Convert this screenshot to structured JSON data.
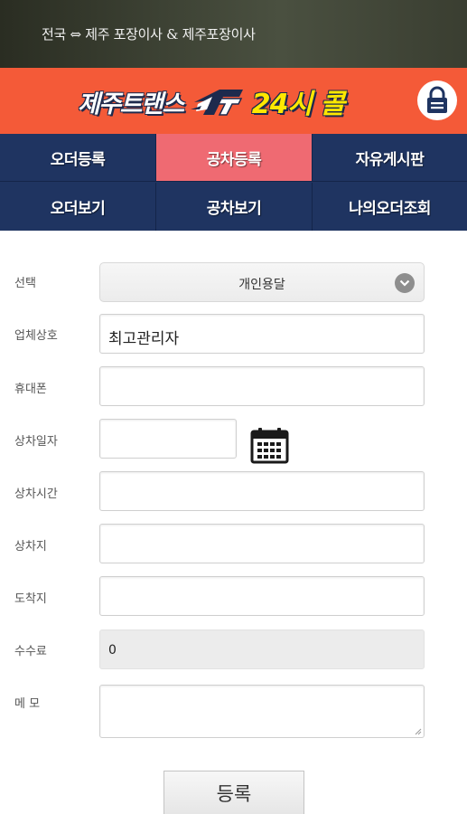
{
  "header": {
    "title": "전국 ⇔ 제주 포장이사 & 제주포장이사"
  },
  "brand": {
    "name": "제주트랜스",
    "hours": "24시 콜",
    "accent_color": "#f45a38",
    "hours_color": "#ffe800"
  },
  "nav": {
    "items": [
      {
        "label": "오더등록",
        "active": false
      },
      {
        "label": "공차등록",
        "active": true
      },
      {
        "label": "자유게시판",
        "active": false
      },
      {
        "label": "오더보기",
        "active": false
      },
      {
        "label": "공차보기",
        "active": false
      },
      {
        "label": "나의오더조회",
        "active": false
      }
    ]
  },
  "form": {
    "select": {
      "label": "선택",
      "value": "개인용달"
    },
    "company": {
      "label": "업체상호",
      "value": "최고관리자"
    },
    "phone": {
      "label": "휴대폰",
      "value": ""
    },
    "load_date": {
      "label": "상차일자",
      "value": "",
      "icon": "calendar-icon"
    },
    "load_time": {
      "label": "상차시간",
      "value": ""
    },
    "origin": {
      "label": "상차지",
      "value": ""
    },
    "destination": {
      "label": "도착지",
      "value": ""
    },
    "fee": {
      "label": "수수료",
      "value": "0"
    },
    "memo": {
      "label": "메 모",
      "value": ""
    },
    "submit_label": "등록"
  }
}
